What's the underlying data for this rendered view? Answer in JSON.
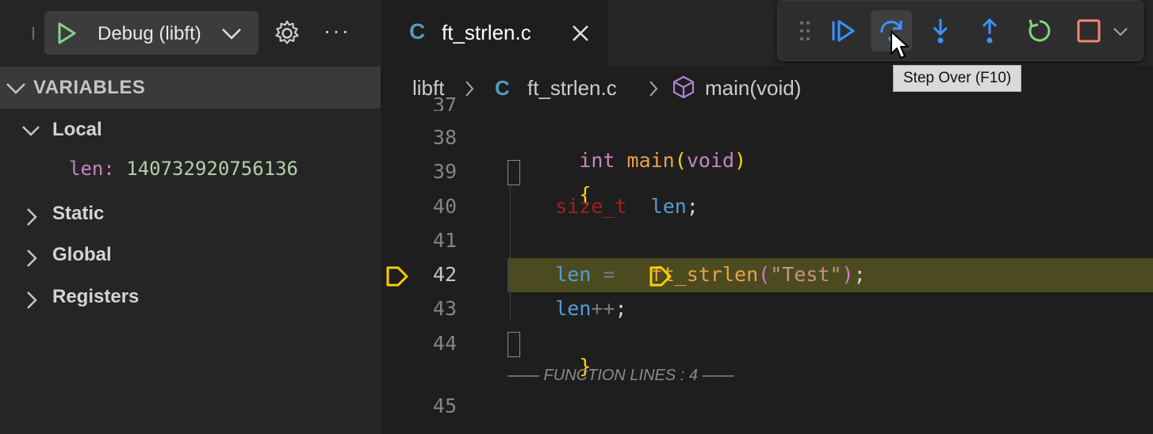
{
  "sidebar": {
    "debug_config": "Debug (libft)",
    "section_title": "VARIABLES",
    "groups": [
      {
        "label": "Local"
      },
      {
        "label": "Static"
      },
      {
        "label": "Global"
      },
      {
        "label": "Registers"
      }
    ],
    "local_var": {
      "name": "len:",
      "value": "140732920756136"
    }
  },
  "editor": {
    "tab": {
      "icon": "C",
      "name": "ft_strlen.c"
    },
    "breadcrumb": {
      "folder": "libft",
      "file_icon": "C",
      "file": "ft_strlen.c",
      "symbol": "main(void)"
    },
    "line_numbers": [
      "37",
      "38",
      "39",
      "40",
      "41",
      "42",
      "43",
      "44",
      "45"
    ],
    "code": {
      "l38": {
        "kw": "int",
        "fn": "main",
        "open": "(",
        "arg": "void",
        "close": ")"
      },
      "l39": {
        "brace": "{"
      },
      "l40": {
        "type": "size_t",
        "var": "len",
        "semi": ";"
      },
      "l42": {
        "var": "len",
        "op": "=",
        "fn": "ft_strlen",
        "open": "(",
        "str": "\"Test\"",
        "close": ")",
        "semi": ";"
      },
      "l43": {
        "var": "len",
        "op": "++",
        "semi": ";"
      },
      "l44": {
        "brace": "}"
      }
    },
    "function_lines": "—— FUNCTION LINES : 4 ——"
  },
  "debug_toolbar": {
    "buttons": [
      "continue",
      "step-over",
      "step-into",
      "step-out",
      "restart",
      "stop"
    ],
    "tooltip": "Step Over (F10)"
  },
  "colors": {
    "accent_blue": "#3794ff",
    "restart_green": "#89d185",
    "stop_red": "#f48771",
    "current_line": "#4b4b1f",
    "execution_arrow": "#ffcc00"
  }
}
